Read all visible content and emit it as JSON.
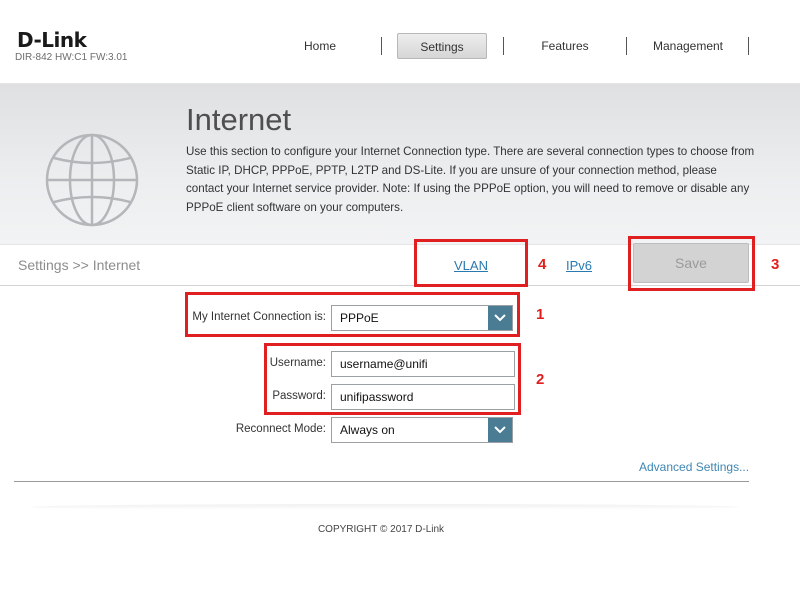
{
  "brand": {
    "logo": "D-Link",
    "model": "DIR-842 HW:C1 FW:3.01"
  },
  "nav": {
    "home": "Home",
    "settings": "Settings",
    "features": "Features",
    "management": "Management"
  },
  "hero": {
    "icon": "globe-icon",
    "title": "Internet",
    "description": "Use this section to configure your Internet Connection type. There are several connection types to choose from Static IP, DHCP, PPPoE, PPTP, L2TP and DS-Lite. If you are unsure of your connection method, please contact your Internet service provider. Note: If using the PPPoE option, you will need to remove or disable any PPPoE client software on your computers."
  },
  "subbar": {
    "breadcrumb": "Settings >> Internet",
    "vlan": "VLAN",
    "ipv6": "IPv6",
    "save": "Save"
  },
  "annotations": [
    "1",
    "2",
    "3",
    "4"
  ],
  "form": {
    "connection_label": "My Internet Connection is:",
    "connection_value": "PPPoE",
    "username_label": "Username:",
    "username_value": "username@unifi",
    "password_label": "Password:",
    "password_value": "unifipassword",
    "reconnect_label": "Reconnect Mode:",
    "reconnect_value": "Always on",
    "advanced": "Advanced Settings..."
  },
  "footer": {
    "copyright": "COPYRIGHT © 2017 D-Link"
  },
  "colors": {
    "annotation": "#e02020",
    "link": "#2a7ab0",
    "select_arrow": "#4a7c93"
  }
}
